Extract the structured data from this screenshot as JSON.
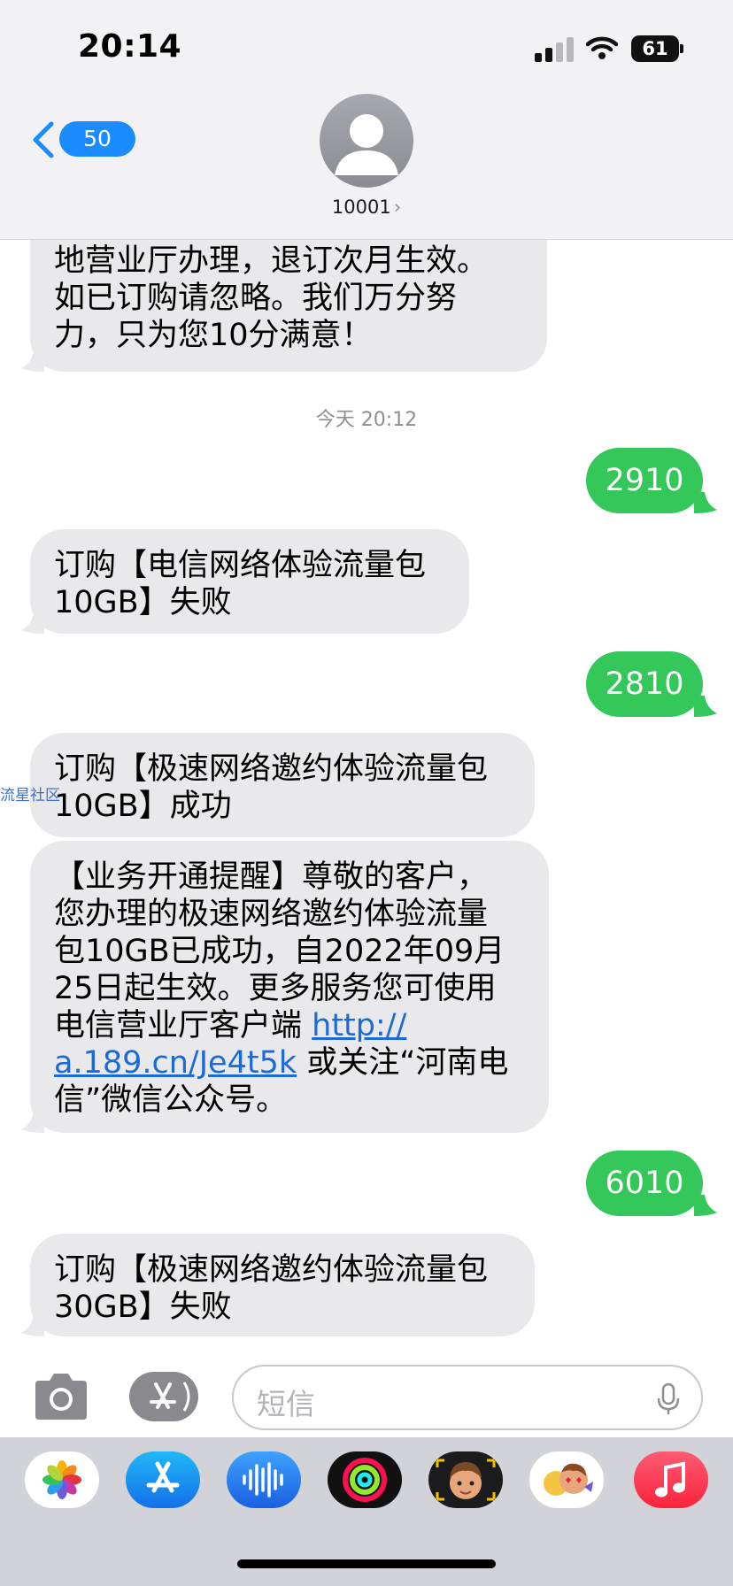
{
  "status_bar": {
    "time": "20:14",
    "battery": "61"
  },
  "header": {
    "back_count": "50",
    "contact_name": "10001",
    "contact_chevron": "›"
  },
  "messages": [
    {
      "text": "地营业厅办理，退订次月生效。\n如已订购请忽略。我们万分努\n力，只为您10分满意！"
    },
    {
      "text": "2910"
    },
    {
      "text": "订购【电信网络体验流量包\n10GB】失败"
    },
    {
      "text": "2810"
    },
    {
      "text": "订购【极速网络邀约体验流量包\n10GB】成功"
    },
    {
      "text_before": "【业务开通提醒】尊敬的客户，\n您办理的极速网络邀约体验流量\n包10GB已成功，自2022年09月\n25日起生效。更多服务您可使用\n电信营业厅客户端 ",
      "link": "http://\na.189.cn/Je4t5k",
      "text_after": " 或关注“河南电\n信”微信公众号。"
    },
    {
      "text": "6010"
    },
    {
      "text": "订购【极速网络邀约体验流量包\n30GB】失败"
    }
  ],
  "timestamp": "今天 20:12",
  "watermark": "流星社区",
  "input": {
    "placeholder": "短信"
  },
  "colors": {
    "sent_bubble": "#34c759",
    "recv_bubble": "#e9e9eb",
    "accent": "#1a8cff"
  },
  "dock": {
    "apps": [
      "photos-icon",
      "app-store-icon",
      "audio-icon",
      "fitness-icon",
      "memoji-icon",
      "stickers-icon",
      "music-icon"
    ]
  }
}
